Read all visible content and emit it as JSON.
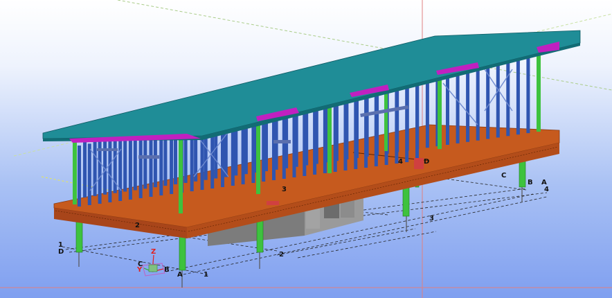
{
  "colors": {
    "roof": "#1f8d97",
    "roof_fascia": "#c020c0",
    "floor_deck": "#c65a1e",
    "stud": "#2f55b0",
    "post": "#3ec23e",
    "foundation": "#8a8a8a",
    "ground_grid": "#d8e4ff"
  },
  "grid_labels": {
    "g1a": "1",
    "g1b": "1",
    "g1c": "1",
    "g2a": "2",
    "g2b": "2",
    "g3a": "3",
    "g3b": "3",
    "g4a": "4",
    "g4b": "4",
    "ga": "A",
    "gb": "A",
    "gbb": "B",
    "gc": "C",
    "gd": "D",
    "gd2": "D"
  },
  "axis_triad": {
    "z": "Z",
    "y": "Y",
    "x": "B",
    "c": "C"
  }
}
